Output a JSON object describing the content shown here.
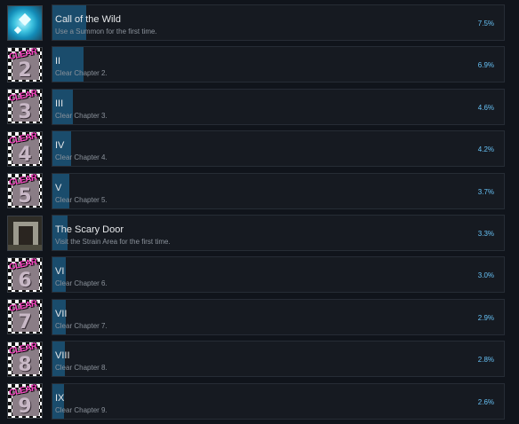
{
  "achievements": [
    {
      "icon": "summon-icon",
      "title": "Call of the Wild",
      "description": "Use a Summon for the first time.",
      "percent": "7.5%",
      "rate": 7.5
    },
    {
      "icon": "clear-chapter-icon",
      "chapter_number": "2",
      "title": "II",
      "description": "Clear Chapter 2.",
      "percent": "6.9%",
      "rate": 6.9
    },
    {
      "icon": "clear-chapter-icon",
      "chapter_number": "3",
      "title": "III",
      "description": "Clear Chapter 3.",
      "percent": "4.6%",
      "rate": 4.6
    },
    {
      "icon": "clear-chapter-icon",
      "chapter_number": "4",
      "title": "IV",
      "description": "Clear Chapter 4.",
      "percent": "4.2%",
      "rate": 4.2
    },
    {
      "icon": "clear-chapter-icon",
      "chapter_number": "5",
      "title": "V",
      "description": "Clear Chapter 5.",
      "percent": "3.7%",
      "rate": 3.7
    },
    {
      "icon": "strain-area-door-icon",
      "title": "The Scary Door",
      "description": "Visit the Strain Area for the first time.",
      "percent": "3.3%",
      "rate": 3.3
    },
    {
      "icon": "clear-chapter-icon",
      "chapter_number": "6",
      "title": "VI",
      "description": "Clear Chapter 6.",
      "percent": "3.0%",
      "rate": 3.0
    },
    {
      "icon": "clear-chapter-icon",
      "chapter_number": "7",
      "title": "VII",
      "description": "Clear Chapter 7.",
      "percent": "2.9%",
      "rate": 2.9
    },
    {
      "icon": "clear-chapter-icon",
      "chapter_number": "8",
      "title": "VIII",
      "description": "Clear Chapter 8.",
      "percent": "2.8%",
      "rate": 2.8
    },
    {
      "icon": "clear-chapter-icon",
      "chapter_number": "9",
      "title": "IX",
      "description": "Clear Chapter 9.",
      "percent": "2.6%",
      "rate": 2.6
    }
  ],
  "badge_text": "CLEAR",
  "colors": {
    "background": "#10141b",
    "row_background": "#161a21",
    "progress_fill": "#1a4c6c",
    "percent_text": "#66c0f4",
    "badge_pink": "#ff47c8"
  }
}
